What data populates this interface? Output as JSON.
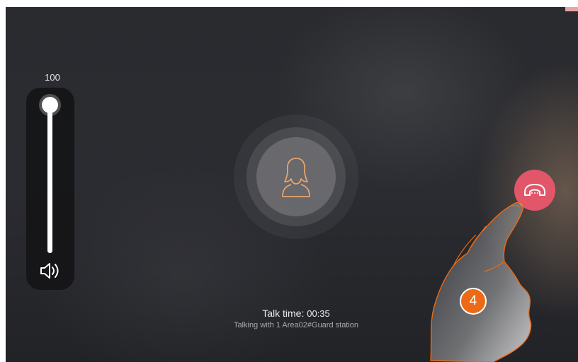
{
  "volume": {
    "value": "100",
    "level": 1.0,
    "icon": "speaker-icon"
  },
  "call": {
    "talk_time_label": "Talk time:",
    "talk_time_value": "00:35",
    "talking_with": "Talking with 1 Area02#Guard station",
    "avatar_icon": "person-icon",
    "hangup_icon": "phone-hangup-icon"
  },
  "annotation": {
    "step_number": "4",
    "hand_icon": "pointing-hand-icon"
  },
  "colors": {
    "accent": "#e8a36a",
    "hangup": "#e2566a",
    "step_badge": "#ec6a15"
  }
}
